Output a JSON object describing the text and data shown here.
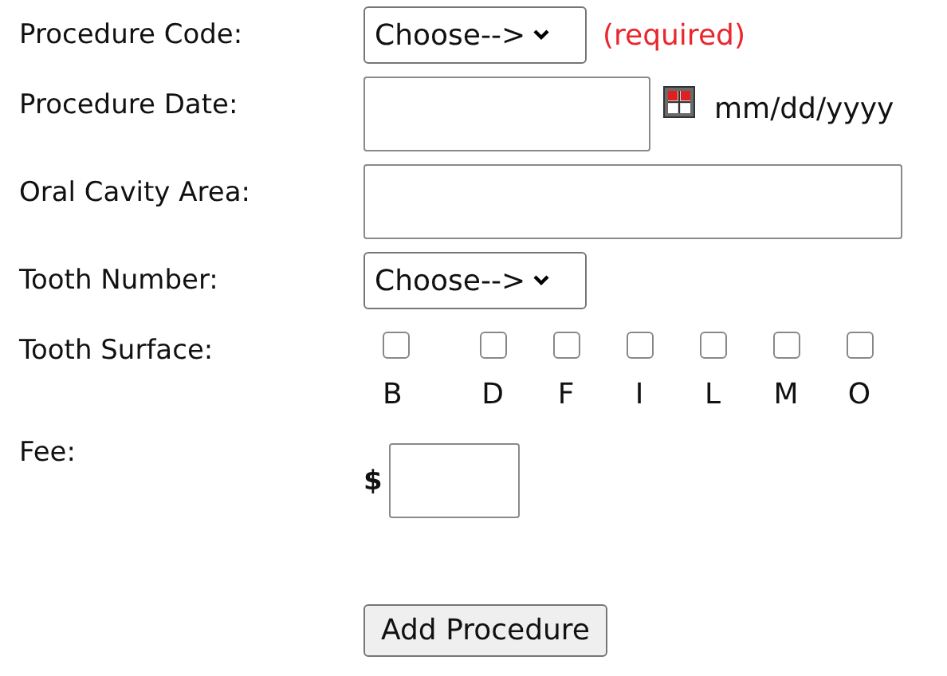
{
  "fields": [
    {
      "kind": "select",
      "label": "Procedure Code:",
      "value": "Choose-->",
      "note": "(required)"
    },
    {
      "kind": "date",
      "label": "Procedure Date:",
      "hint": "mm/dd/yyyy"
    },
    {
      "kind": "text",
      "label": "Oral Cavity Area:"
    },
    {
      "kind": "select",
      "label": "Tooth Number:",
      "value": "Choose-->"
    },
    {
      "kind": "checkboxes",
      "label": "Tooth Surface:",
      "options": [
        {
          "label": "B",
          "checked": false
        },
        {
          "label": "D",
          "checked": false
        },
        {
          "label": "F",
          "checked": false
        },
        {
          "label": "I",
          "checked": false
        },
        {
          "label": "L",
          "checked": false
        },
        {
          "label": "M",
          "checked": false
        },
        {
          "label": "O",
          "checked": false
        }
      ]
    },
    {
      "kind": "money",
      "label": "Fee:",
      "prefix": "$"
    }
  ],
  "button": "Add Procedure"
}
